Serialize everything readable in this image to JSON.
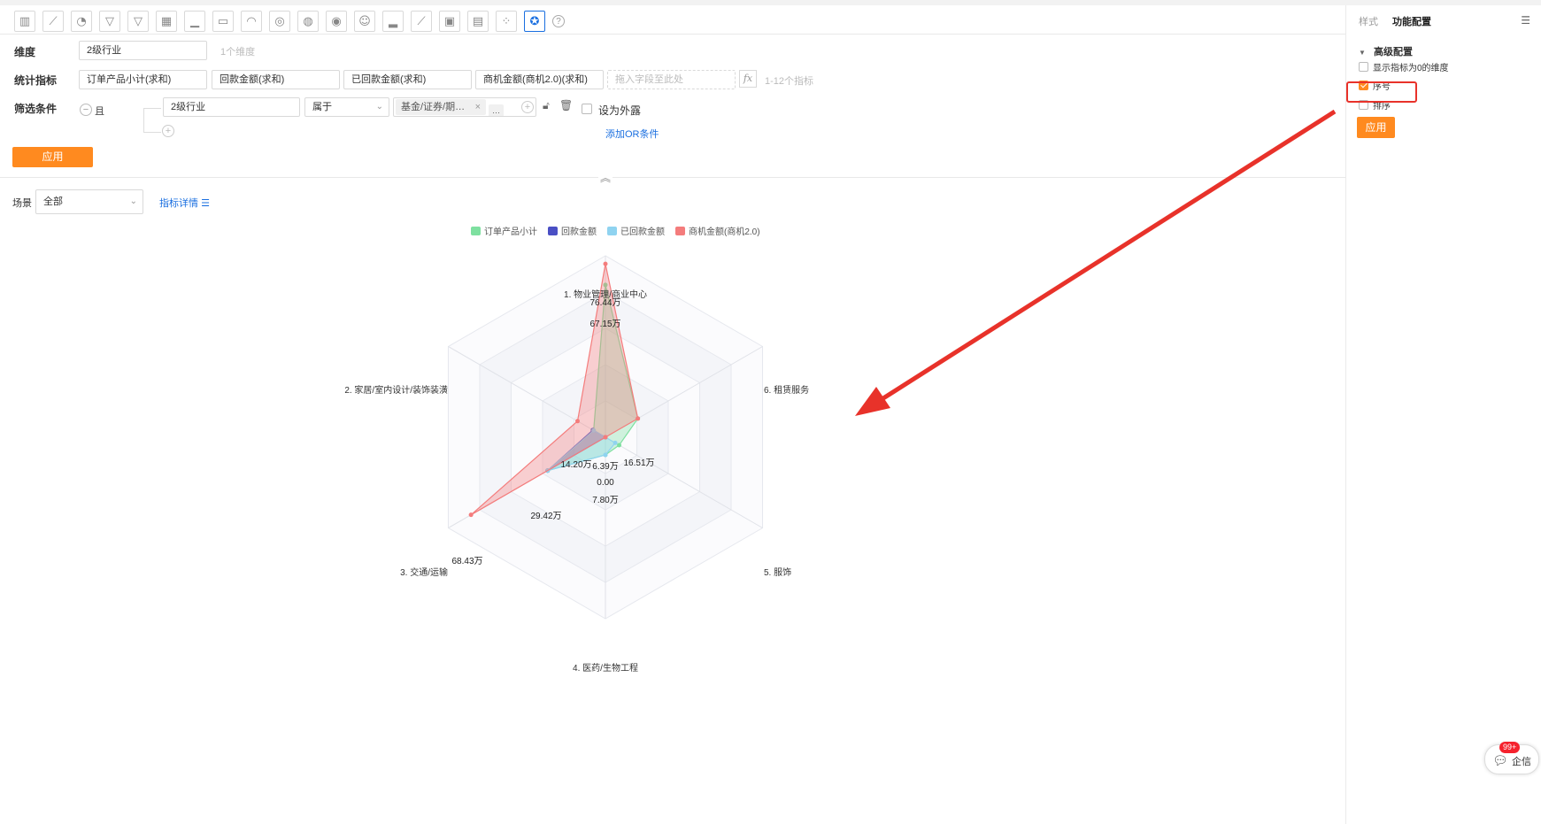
{
  "toolbar": {
    "icons": [
      "bar-chart-icon",
      "line-chart-icon",
      "pie-chart-icon",
      "funnel-icon",
      "funnel2-icon",
      "table-icon",
      "combo-chart-icon",
      "card-icon",
      "gauge-icon",
      "map-icon",
      "map2-icon",
      "map3-icon",
      "wordcloud-icon",
      "column-icon",
      "area-icon",
      "matrix-icon",
      "pivot-icon",
      "scatter-icon",
      "radar-icon"
    ],
    "help": "?"
  },
  "form": {
    "dimension_label": "维度",
    "dimension_value": "2级行业",
    "dimension_hint": "1个维度",
    "metrics_label": "统计指标",
    "metrics": [
      "订单产品小计(求和)",
      "回款金额(求和)",
      "已回款金额(求和)",
      "商机金额(商机2.0)(求和)"
    ],
    "metrics_placeholder": "拖入字段至此处",
    "fx": "fx",
    "metrics_hint": "1-12个指标",
    "filter_label": "筛选条件",
    "filter_and": "且",
    "filter_field": "2级行业",
    "filter_op": "属于",
    "filter_value": "基金/证券/期…",
    "filter_more": "···",
    "expose_label": "设为外露",
    "add_or": "添加OR条件",
    "apply": "应用"
  },
  "scene": {
    "label": "场景",
    "value": "全部",
    "detail_link": "指标详情"
  },
  "chart_data": {
    "type": "radar",
    "axes": [
      "1. 物业管理/商业中心",
      "2. 家居/室内设计/装饰装潢",
      "3. 交通/运输",
      "4. 医药/生物工程",
      "5. 服饰",
      "6. 租赁服务"
    ],
    "series": [
      {
        "name": "订单产品小计",
        "color": "#7ee0a0",
        "values": [
          67.15,
          6,
          29.42,
          7.8,
          7,
          16.51
        ]
      },
      {
        "name": "回款金额",
        "color": "#4a4fc4",
        "values": [
          0,
          6.39,
          29.42,
          0,
          0,
          0
        ]
      },
      {
        "name": "已回款金额",
        "color": "#8fd3f0",
        "values": [
          0,
          6,
          29.42,
          7.8,
          5,
          0
        ]
      },
      {
        "name": "商机金额(商机2.0)",
        "color": "#f47c7c",
        "values": [
          76.44,
          14.2,
          68.43,
          0,
          0,
          16.51
        ]
      }
    ],
    "max": 80,
    "data_labels": [
      "76.44万",
      "67.15万",
      "14.20万",
      "6.39万",
      "16.51万",
      "0.00",
      "7.80万",
      "29.42万",
      "68.43万"
    ]
  },
  "panel": {
    "tab_style": "样式",
    "tab_func": "功能配置",
    "section": "高级配置",
    "options": [
      {
        "label": "显示指标为0的维度",
        "checked": false
      },
      {
        "label": "序号",
        "checked": true
      },
      {
        "label": "排序",
        "checked": false
      }
    ],
    "apply": "应用"
  },
  "chat": {
    "badge": "99+",
    "label": "企信"
  }
}
